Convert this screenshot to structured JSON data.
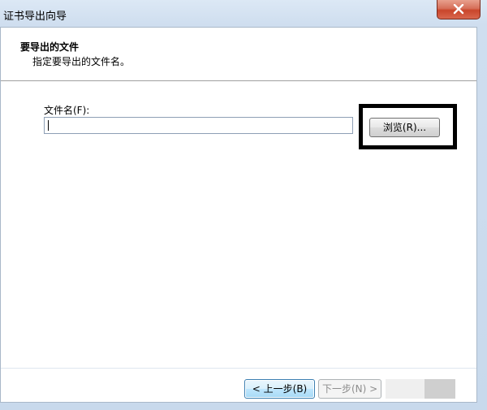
{
  "window": {
    "title": "证书导出向导"
  },
  "header": {
    "title": "要导出的文件",
    "subtitle": "指定要导出的文件名。"
  },
  "form": {
    "file_label": "文件名(F):",
    "file_value": "",
    "browse_label": "浏览(R)..."
  },
  "footer": {
    "back_label": "< 上一步(B)",
    "next_label": "下一步(N) >"
  },
  "icons": {
    "close": "close-icon"
  },
  "colors": {
    "close_button": "#c9452b",
    "highlight_frame": "#000000",
    "focused_button_border": "#3c7fb1"
  }
}
